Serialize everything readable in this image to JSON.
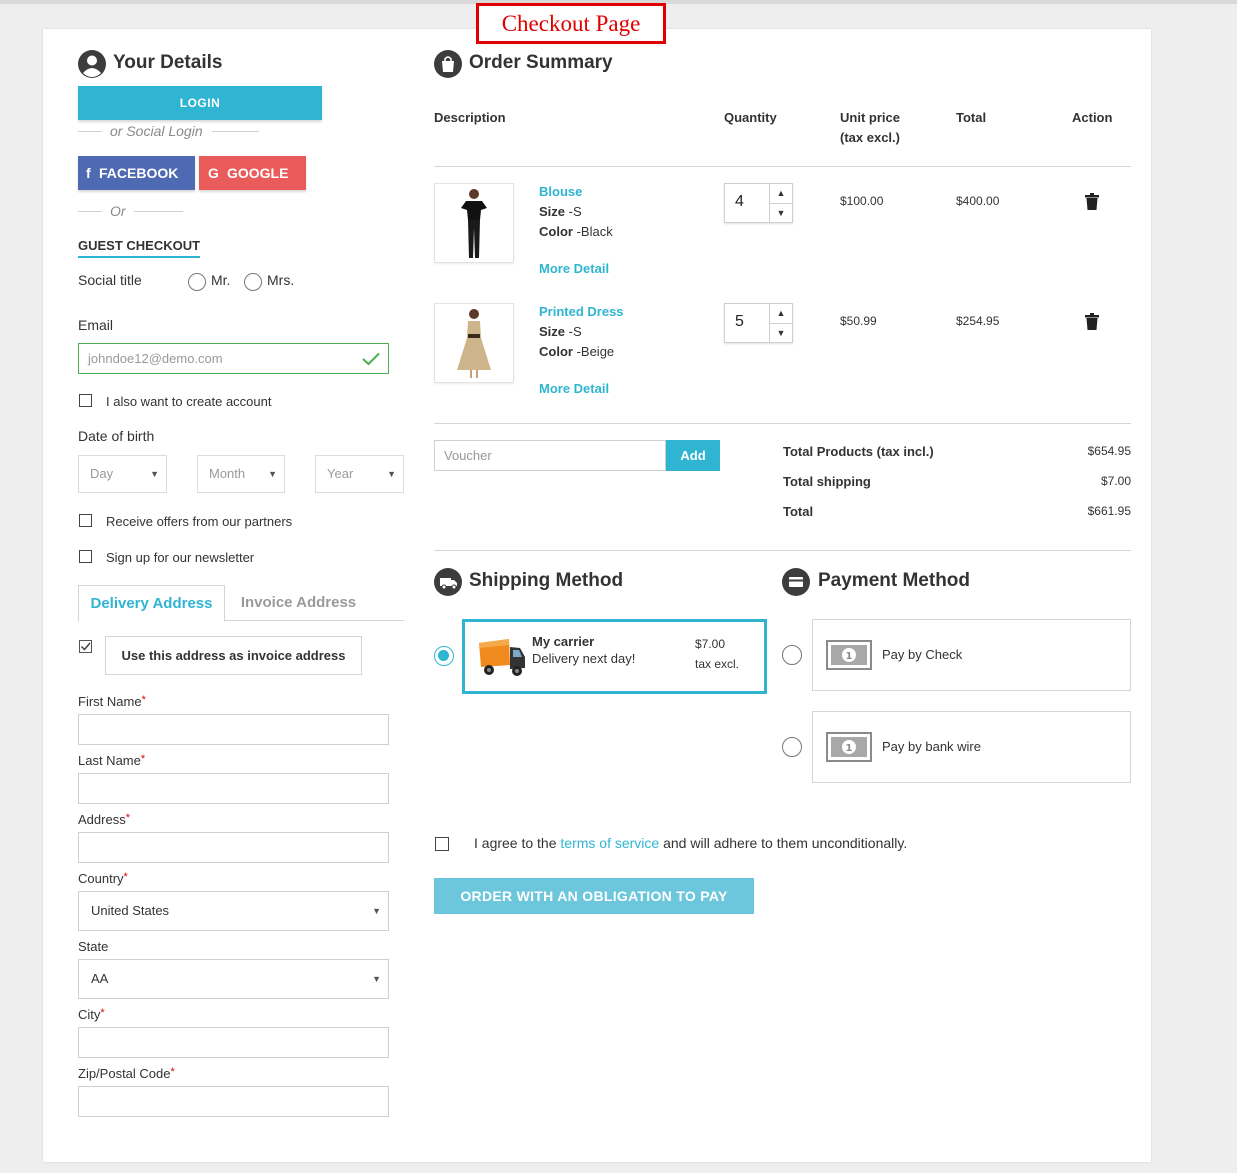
{
  "page_label": "Checkout Page",
  "your_details": {
    "title": "Your Details",
    "login_label": "LOGIN",
    "social_login_text": "or Social Login",
    "facebook_label": "FACEBOOK",
    "google_label": "GOOGLE",
    "or_text": "Or",
    "guest_checkout": "GUEST CHECKOUT",
    "social_title_label": "Social title",
    "mr_label": "Mr.",
    "mrs_label": "Mrs.",
    "email_label": "Email",
    "email_placeholder": "johndoe12@demo.com",
    "create_account_label": "I also want to create account",
    "dob_label": "Date of birth",
    "day_label": "Day",
    "month_label": "Month",
    "year_label": "Year",
    "offers_label": "Receive offers from our partners",
    "newsletter_label": "Sign up for our newsletter"
  },
  "address": {
    "tab_delivery": "Delivery Address",
    "tab_invoice": "Invoice Address",
    "use_as_invoice": "Use this address as invoice address",
    "first_name": "First Name",
    "last_name": "Last Name",
    "address": "Address",
    "country": "Country",
    "country_value": "United States",
    "state": "State",
    "state_value": "AA",
    "city": "City",
    "zip": "Zip/Postal Code"
  },
  "order_summary": {
    "title": "Order Summary",
    "col_description": "Description",
    "col_quantity": "Quantity",
    "col_unit_price_1": "Unit price",
    "col_unit_price_2": "(tax excl.)",
    "col_total": "Total",
    "col_action": "Action",
    "size_label": "Size",
    "color_label": "Color",
    "more_detail": "More Detail",
    "items": [
      {
        "name": "Blouse",
        "size": "-S",
        "color": "-Black",
        "qty": "4",
        "unit_price": "$100.00",
        "total": "$400.00"
      },
      {
        "name": "Printed Dress",
        "size": "-S",
        "color": "-Beige",
        "qty": "5",
        "unit_price": "$50.99",
        "total": "$254.95"
      }
    ],
    "voucher_placeholder": "Voucher",
    "voucher_add": "Add",
    "total_products_label": "Total Products (tax incl.)",
    "total_products_value": "$654.95",
    "total_shipping_label": "Total shipping",
    "total_shipping_value": "$7.00",
    "total_label": "Total",
    "total_value": "$661.95"
  },
  "shipping": {
    "title": "Shipping Method",
    "carrier_name": "My carrier",
    "carrier_desc": "Delivery next day!",
    "carrier_price": "$7.00",
    "carrier_tax": "tax excl."
  },
  "payment": {
    "title": "Payment Method",
    "check": "Pay by Check",
    "wire": "Pay by bank wire"
  },
  "terms": {
    "prefix": "I agree to the",
    "link": "terms of service",
    "suffix": "and will adhere to them unconditionally."
  },
  "order_button": "ORDER WITH AN OBLIGATION TO PAY",
  "colors": {
    "accent": "#2fb5d2",
    "facebook": "#4d6ab2",
    "google": "#ea5b5b",
    "label_border": "#e00000"
  }
}
